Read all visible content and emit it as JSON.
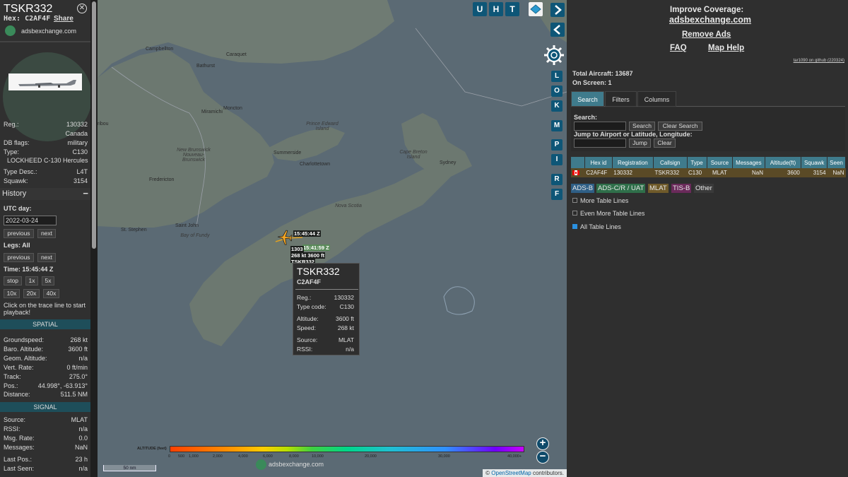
{
  "sidebar": {
    "callsign": "TSKR332",
    "hex_line": "Hex: C2AF4F",
    "share": "Share",
    "site": "adsbexchange.com",
    "details": [
      {
        "key": "Reg.:",
        "value": "130332"
      },
      {
        "key": "",
        "value": "Canada"
      },
      {
        "key": "DB flags:",
        "value": "military"
      },
      {
        "key": "Type:",
        "value": "C130"
      }
    ],
    "type_full": "LOCKHEED C-130 Hercules",
    "details2": [
      {
        "key": "Type Desc.:",
        "value": "L4T"
      },
      {
        "key": "Squawk:",
        "value": "3154"
      }
    ],
    "history": {
      "title": "History",
      "collapse": "−",
      "utc_day_label": "UTC day:",
      "date": "2022-03-24",
      "previous": "previous",
      "next": "next",
      "legs_label": "Legs: All",
      "time_label": "Time: 15:45:44 Z",
      "controls": [
        "stop",
        "1x",
        "5x"
      ],
      "speeds": [
        "10x",
        "20x",
        "40x"
      ],
      "hint": "Click on the trace line to start playback!"
    },
    "spatial": {
      "title": "SPATIAL",
      "rows": [
        {
          "key": "Groundspeed:",
          "value": "268 kt"
        },
        {
          "key": "Baro. Altitude:",
          "value": "3600 ft"
        },
        {
          "key": "Geom. Altitude:",
          "value": "n/a"
        },
        {
          "key": "Vert. Rate:",
          "value": "0 ft/min"
        },
        {
          "key": "Track:",
          "value": "275.0°"
        },
        {
          "key": "Pos.:",
          "value": "44.998°, -63.913°"
        },
        {
          "key": "Distance:",
          "value": "511.5 NM"
        }
      ]
    },
    "signal": {
      "title": "SIGNAL",
      "rows": [
        {
          "key": "Source:",
          "value": "MLAT"
        },
        {
          "key": "RSSI:",
          "value": "n/a"
        },
        {
          "key": "Msg. Rate:",
          "value": "0.0"
        },
        {
          "key": "Messages:",
          "value": "NaN"
        },
        {
          "key": "Last Pos.:",
          "value": "23 h"
        },
        {
          "key": "Last Seen:",
          "value": "n/a"
        }
      ]
    }
  },
  "map": {
    "top_buttons": [
      "U",
      "H",
      "T"
    ],
    "side_buttons": [
      "L",
      "O",
      "K",
      "M",
      "P",
      "I",
      "R",
      "F"
    ],
    "cities": [
      "Campbellton",
      "Bathurst",
      "Caraquet",
      "Miramichi",
      "Moncton",
      "Summerside",
      "Charlottetown",
      "Sydney",
      "Fredericton",
      "Saint John",
      "St. Stephen",
      "ribou"
    ],
    "regions": [
      "Prince Edward Island",
      "New Brunswick Nouveau-Brunswick",
      "Cape Breton Island",
      "Nova Scotia",
      "Bay of Fundy"
    ],
    "plane_labels": {
      "time": "15:45:44 Z",
      "trace_time": "15:41:59 Z",
      "line1": "1303",
      "line2": "268 kt  3600 ft",
      "line3": "TSKR332"
    },
    "popup": {
      "callsign": "TSKR332",
      "hex": "C2AF4F",
      "rows": [
        {
          "key": "Reg.:",
          "value": "130332"
        },
        {
          "key": "Type code:",
          "value": "C130"
        },
        {
          "key": "Altitude:",
          "value": "3600 ft"
        },
        {
          "key": "Speed:",
          "value": "268 kt"
        },
        {
          "key": "Source:",
          "value": "MLAT"
        },
        {
          "key": "RSSI:",
          "value": "n/a"
        }
      ]
    },
    "altitude_legend": {
      "title": "ALTITUDE (feet)",
      "ticks": [
        "0",
        "500",
        "1,000",
        "2,000",
        "4,000",
        "6,000",
        "8,000",
        "10,000",
        "20,000",
        "30,000",
        "40,000+"
      ]
    },
    "scale": "50 nm",
    "logo_text": "adsbexchange.com",
    "attribution_prefix": "© ",
    "attribution_link": "OpenStreetMap",
    "attribution_suffix": " contributors.",
    "zoom_in": "+",
    "zoom_out": "−"
  },
  "right": {
    "improve": "Improve Coverage:",
    "site": "adsbexchange.com",
    "remove_ads": "Remove Ads",
    "faq": "FAQ",
    "map_help": "Map Help",
    "github": "tar1090 on github (220324)",
    "total": "Total Aircraft: 13687",
    "onscreen": "On Screen: 1",
    "tabs": [
      "Search",
      "Filters",
      "Columns"
    ],
    "search_label": "Search:",
    "search_btn": "Search",
    "clear_search_btn": "Clear Search",
    "jump_label": "Jump to Airport or Latitude, Longitude:",
    "jump_btn": "Jump",
    "clear_btn": "Clear",
    "table": {
      "headers": [
        "",
        "Hex id",
        "Registration",
        "Callsign",
        "Type",
        "Source",
        "Messages",
        "Altitude(ft)",
        "Squawk",
        "Seen"
      ],
      "row": [
        "",
        "C2AF4F",
        "130332",
        "TSKR332",
        "C130",
        "MLAT",
        "NaN",
        "3600",
        "3154",
        "NaN"
      ]
    },
    "sources": [
      {
        "label": "ADS-B",
        "color": "#2f5f86"
      },
      {
        "label": "ADS-C/R / UAT",
        "color": "#2f6f4a"
      },
      {
        "label": "MLAT",
        "color": "#6f5a2a"
      },
      {
        "label": "TIS-B",
        "color": "#6a2a5a"
      },
      {
        "label": "Other",
        "color": "#3a3a3a"
      }
    ],
    "options": [
      "More Table Lines",
      "Even More Table Lines",
      "All Table Lines"
    ]
  }
}
